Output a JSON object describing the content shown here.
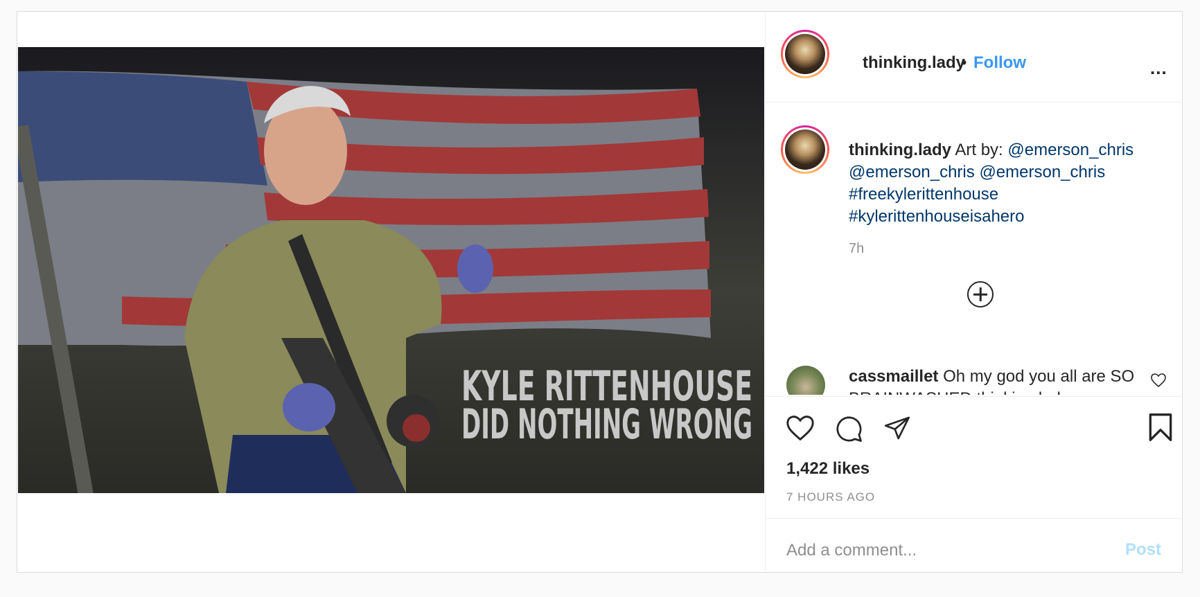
{
  "post": {
    "image_text": {
      "line1": "KYLE RITTENHOUSE",
      "line2": "DID NOTHING WRONG"
    },
    "icons": {
      "more": "more-options-icon",
      "load_more": "plus-circle-icon",
      "comment_like": "heart-icon",
      "like": "heart-icon",
      "comment": "comment-bubble-icon",
      "share": "paper-plane-icon",
      "save": "bookmark-icon"
    }
  },
  "header": {
    "username": "thinking.lady",
    "separator": "•",
    "follow_label": "Follow",
    "more_label": "..."
  },
  "caption": {
    "username": "thinking.lady",
    "prefix": "Art by:",
    "mentions": [
      "@emerson_chris",
      "@emerson_chris",
      "@emerson_chris"
    ],
    "hashtags": [
      "#freekylerittenhouse",
      "#kylerittenhouseisahero"
    ],
    "time": "7h"
  },
  "comments": [
    {
      "username": "cassmaillet",
      "text": "Oh my god you all are SO BRAINWASHED thinking.lady"
    }
  ],
  "actions": {
    "likes": "1,422 likes",
    "timestamp": "7 HOURS AGO"
  },
  "add_comment": {
    "placeholder": "Add a comment...",
    "post_label": "Post"
  },
  "colors": {
    "follow": "#3897f0",
    "link": "#00376b",
    "post_disabled": "#b2dffc",
    "muted": "#8e8e8e"
  }
}
